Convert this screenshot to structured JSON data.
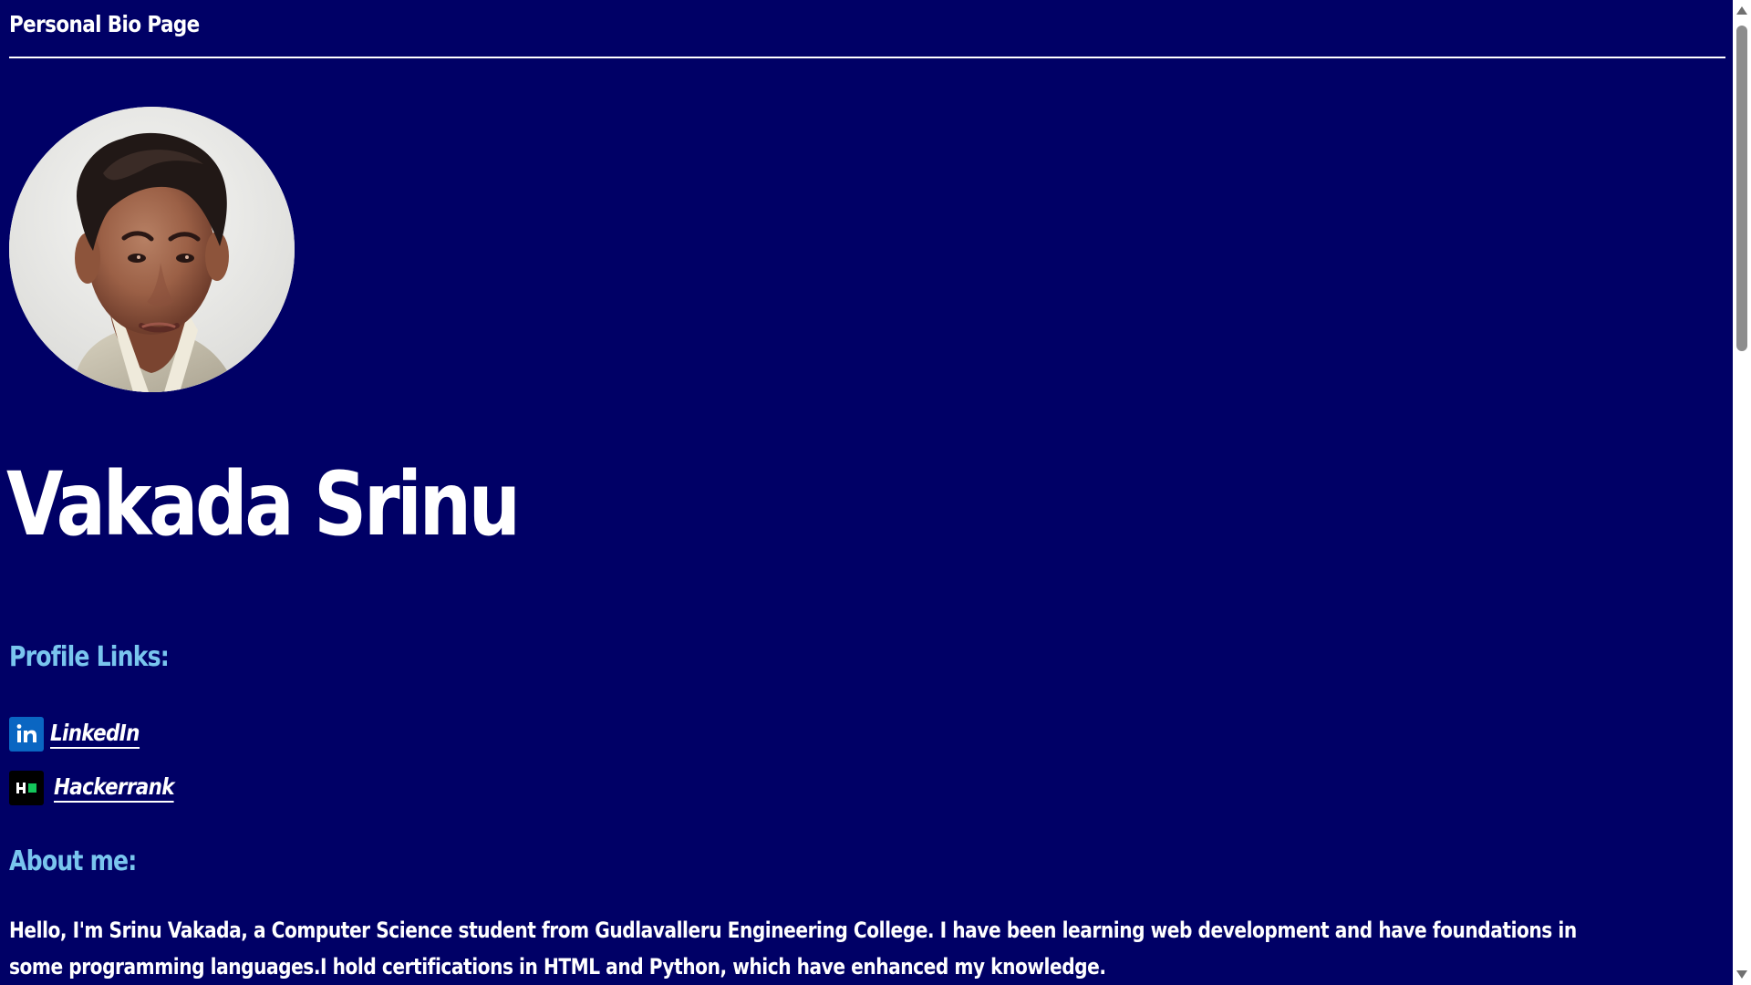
{
  "page": {
    "title": "Personal Bio Page",
    "background_color": "#000066",
    "text_color": "#ffffff",
    "heading_color": "#79c5ee"
  },
  "profile": {
    "image_alt": "profile photo",
    "name": "Vakada Srinu"
  },
  "profile_links": {
    "heading": "Profile Links:",
    "items": [
      {
        "label": "LinkedIn",
        "icon": "linkedin-icon",
        "icon_color": "#0a66c2"
      },
      {
        "label": "Hackerrank",
        "icon": "hackerrank-icon",
        "icon_color": "#000000"
      }
    ]
  },
  "about": {
    "heading": "About me:",
    "text": "Hello, I'm Srinu Vakada, a Computer Science student from Gudlavalleru Engineering College. I have been learning web development and have foundations in some programming languages.I hold certifications in HTML and Python, which have enhanced my knowledge."
  },
  "scrollbar": {
    "track_color": "#ffffff",
    "thumb_color": "#8d8d8d"
  }
}
